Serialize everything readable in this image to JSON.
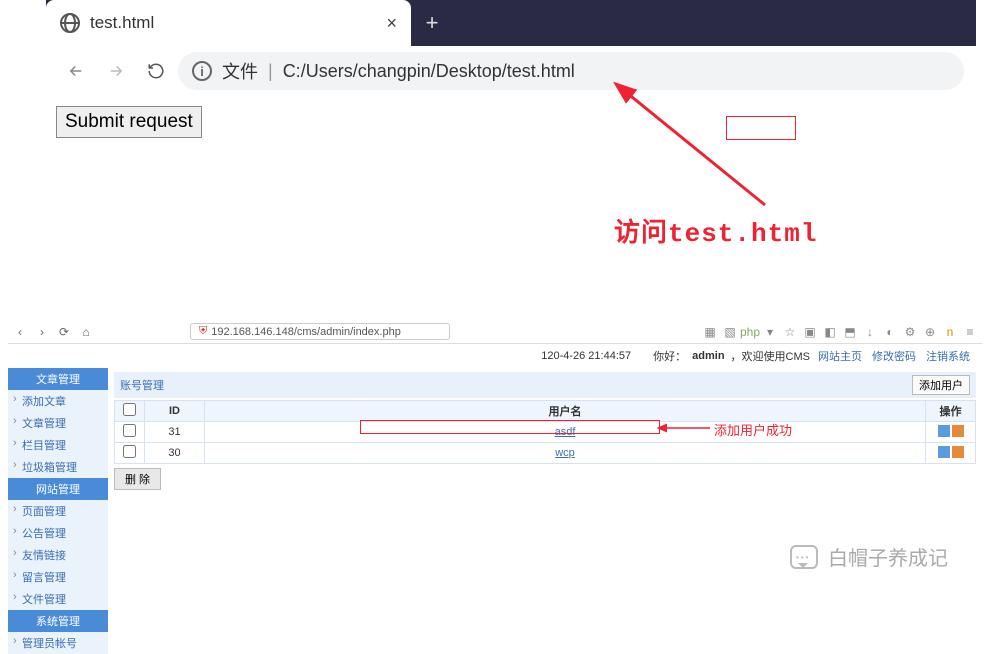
{
  "chrome": {
    "tab_title": "test.html",
    "close_glyph": "×",
    "newtab_glyph": "+",
    "addr_prefix": "文件",
    "addr_path": "C:/Users/changpin/Desktop/test.html",
    "info_glyph": "i"
  },
  "page": {
    "button_label": "Submit request"
  },
  "annotation": {
    "main_text": "访问test.html",
    "user_added_text": "添加用户成功"
  },
  "admin": {
    "url": "192.168.146.148/cms/admin/index.php",
    "timestamp": "120-4-26 21:44:57",
    "greeting": "你好：",
    "username": "admin",
    "welcome": "，欢迎使用CMS",
    "links": {
      "home": "网站主页",
      "pwd": "修改密码",
      "logout": "注销系统"
    },
    "sidebar": {
      "sect1": "文章管理",
      "sect1_items": [
        "添加文章",
        "文章管理",
        "栏目管理",
        "垃圾箱管理"
      ],
      "sect2": "网站管理",
      "sect2_items": [
        "页面管理",
        "公告管理",
        "友情链接",
        "留言管理",
        "文件管理"
      ],
      "sect3": "系统管理",
      "sect3_items": [
        "管理员帐号"
      ]
    },
    "panel_title": "账号管理",
    "add_user_btn": "添加用户",
    "cols": {
      "id": "ID",
      "user": "用户名",
      "op": "操作"
    },
    "rows": [
      {
        "id": "31",
        "user": "asdf"
      },
      {
        "id": "30",
        "user": "wcp"
      }
    ],
    "delete_btn": "删 除"
  },
  "watermark": "白帽子养成记"
}
